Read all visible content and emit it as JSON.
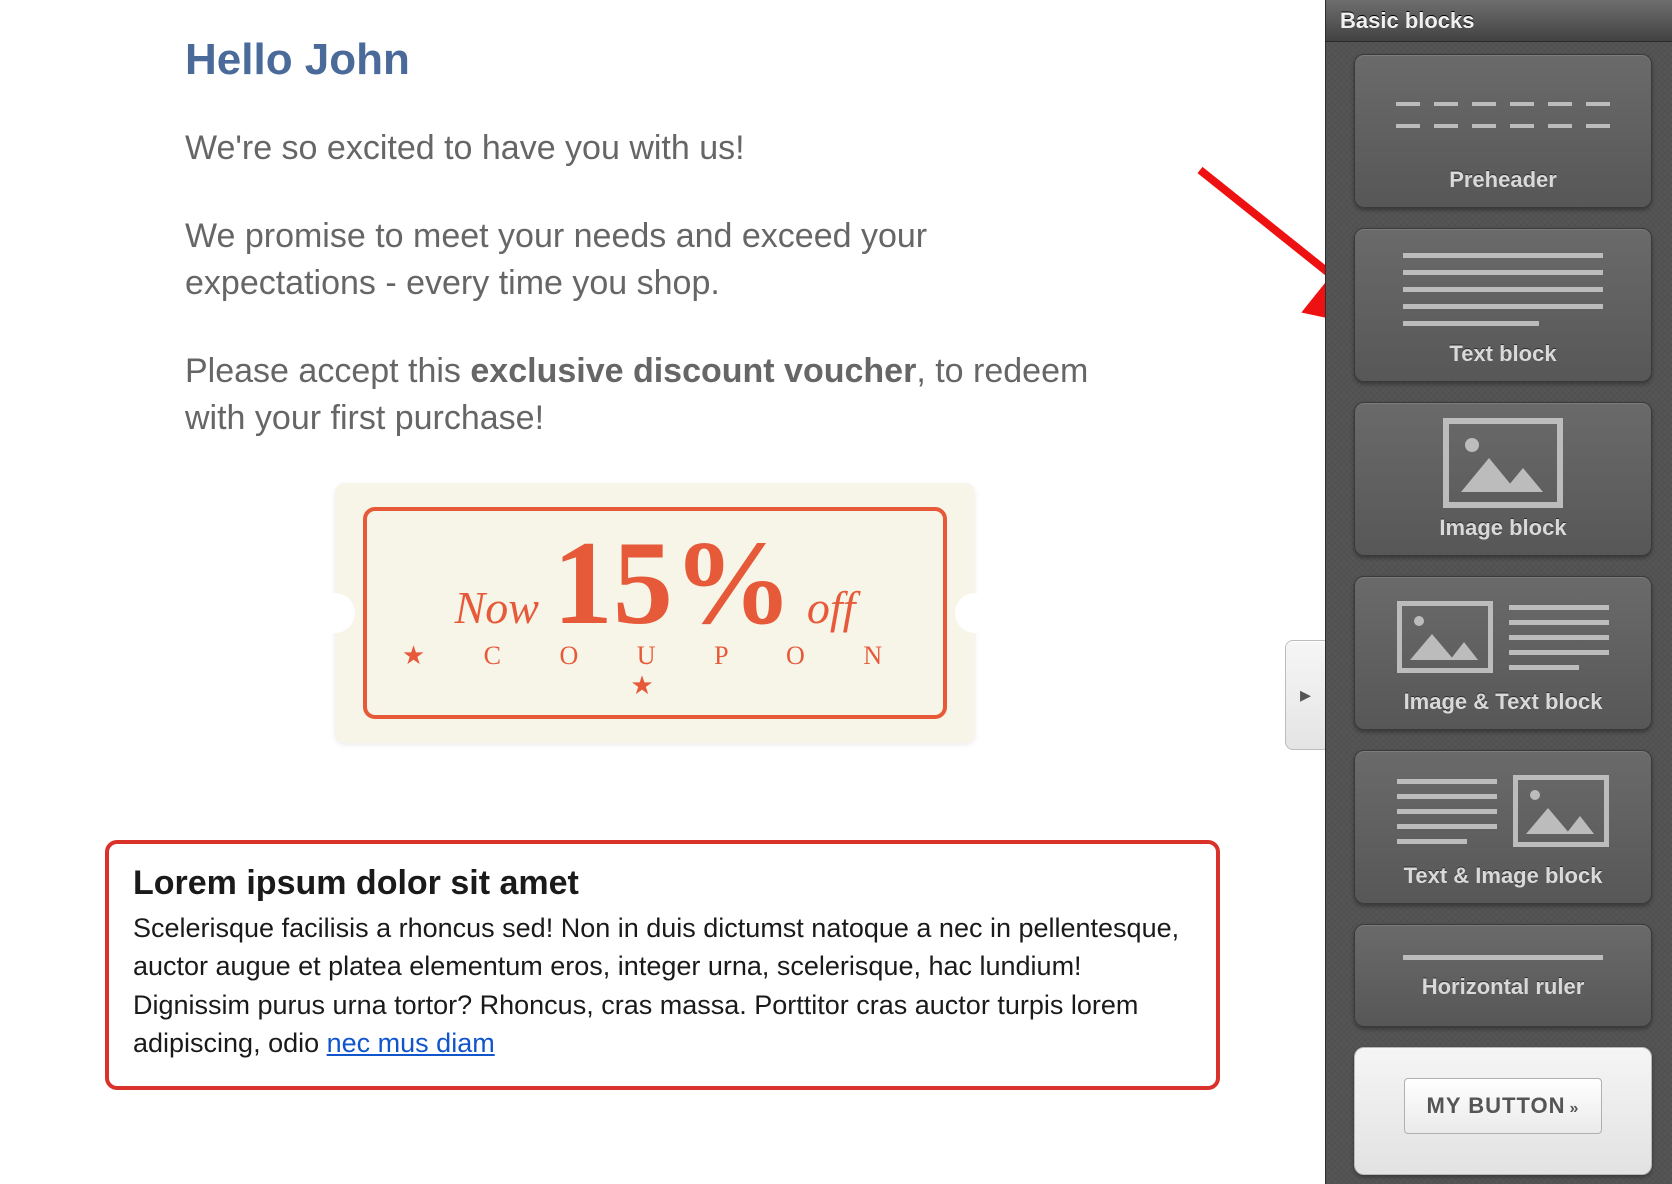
{
  "email": {
    "greeting": "Hello John",
    "para1": "We're so excited to have you with us!",
    "para2": "We promise to meet your needs and exceed your expectations - every time you shop.",
    "para3_pre": "Please accept this ",
    "para3_bold": "exclusive discount voucher",
    "para3_post": ", to redeem with your first purchase!",
    "coupon": {
      "now": "Now",
      "big": "15%",
      "off": "off",
      "label": "C O U P O N"
    },
    "highlight": {
      "title": "Lorem ipsum dolor sit amet",
      "body_pre": "Scelerisque facilisis a rhoncus sed! Non in duis dictumst natoque a nec in pellentesque, auctor augue et platea elementum eros, integer urna, scelerisque, hac lundium! Dignissim purus urna tortor? Rhoncus, cras massa. Porttitor cras auctor turpis lorem adipiscing, odio ",
      "link_text": "nec mus diam"
    }
  },
  "sidebar": {
    "header": "Basic blocks",
    "blocks": {
      "preheader": "Preheader",
      "text": "Text block",
      "image": "Image block",
      "image_text": "Image & Text block",
      "text_image": "Text & Image block",
      "hr": "Horizontal ruler",
      "button_label": "MY BUTTON"
    }
  },
  "collapse_glyph": "▸"
}
